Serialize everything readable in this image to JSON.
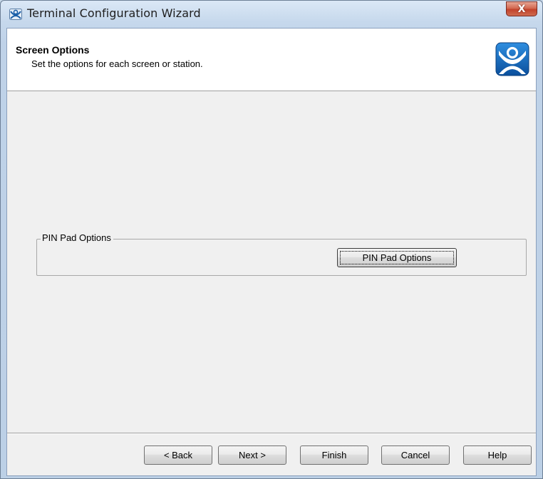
{
  "window": {
    "title": "Terminal Configuration Wizard",
    "close_glyph": "X"
  },
  "header": {
    "title": "Screen Options",
    "subtitle": "Set the options for each screen or station.",
    "logo_icon": "user-logo-icon"
  },
  "pin_group": {
    "label": "PIN Pad Options",
    "button_label": "PIN Pad Options"
  },
  "footer": {
    "back_label": "< Back",
    "next_label": "Next >",
    "finish_label": "Finish",
    "cancel_label": "Cancel",
    "help_label": "Help"
  },
  "colors": {
    "accent": "#0a5fb4",
    "close_button": "#c7432c"
  }
}
